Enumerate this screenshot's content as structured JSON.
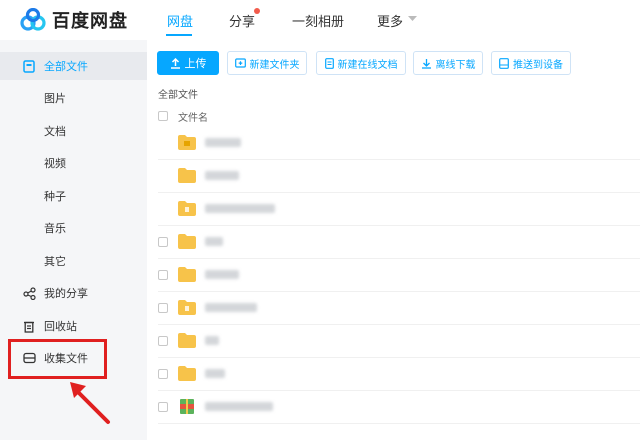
{
  "app": {
    "logo_text": "百度网盘",
    "accent": "#06a7ff"
  },
  "nav": {
    "items": [
      "网盘",
      "分享",
      "一刻相册",
      "更多"
    ]
  },
  "sidebar": {
    "items": [
      {
        "label": "全部文件",
        "icon": "folder-doc-icon"
      },
      {
        "label": "图片"
      },
      {
        "label": "文档"
      },
      {
        "label": "视频"
      },
      {
        "label": "种子"
      },
      {
        "label": "音乐"
      },
      {
        "label": "其它"
      },
      {
        "label": "我的分享",
        "icon": "share-icon"
      },
      {
        "label": "回收站",
        "icon": "trash-icon"
      },
      {
        "label": "收集文件",
        "icon": "inbox-icon"
      }
    ],
    "highlight_color": "#e02020"
  },
  "toolbar": {
    "upload": "上传",
    "new_folder": "新建文件夹",
    "new_online_doc": "新建在线文档",
    "offline_download": "离线下载",
    "push_to_device": "推送到设备"
  },
  "main": {
    "breadcrumb": "全部文件",
    "column_filename": "文件名",
    "rows": [
      {
        "type": "folder-locked",
        "checkbox": false
      },
      {
        "type": "folder",
        "checkbox": false
      },
      {
        "type": "folder-doc",
        "checkbox": false
      },
      {
        "type": "folder",
        "checkbox": true
      },
      {
        "type": "folder",
        "checkbox": true
      },
      {
        "type": "folder-doc",
        "checkbox": true
      },
      {
        "type": "folder",
        "checkbox": true
      },
      {
        "type": "folder",
        "checkbox": true
      },
      {
        "type": "archive",
        "checkbox": true
      }
    ]
  }
}
